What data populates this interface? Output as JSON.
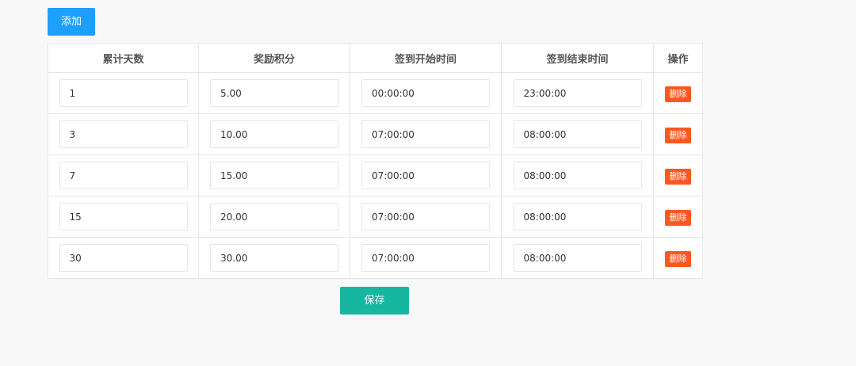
{
  "toolbar": {
    "add_label": "添加",
    "save_label": "保存"
  },
  "table": {
    "headers": [
      "累计天数",
      "奖励积分",
      "签到开始时间",
      "签到结束时间",
      "操作"
    ],
    "delete_label": "删除",
    "rows": [
      {
        "days": "1",
        "points": "5.00",
        "start": "00:00:00",
        "end": "23:00:00"
      },
      {
        "days": "3",
        "points": "10.00",
        "start": "07:00:00",
        "end": "08:00:00"
      },
      {
        "days": "7",
        "points": "15.00",
        "start": "07:00:00",
        "end": "08:00:00"
      },
      {
        "days": "15",
        "points": "20.00",
        "start": "07:00:00",
        "end": "08:00:00"
      },
      {
        "days": "30",
        "points": "30.00",
        "start": "07:00:00",
        "end": "08:00:00"
      }
    ]
  },
  "colors": {
    "add_button": "#1e9fff",
    "delete_button": "#ff5722",
    "save_button": "#16b6a0",
    "border": "#e6e6e6",
    "page_background": "#f8f8f8"
  }
}
